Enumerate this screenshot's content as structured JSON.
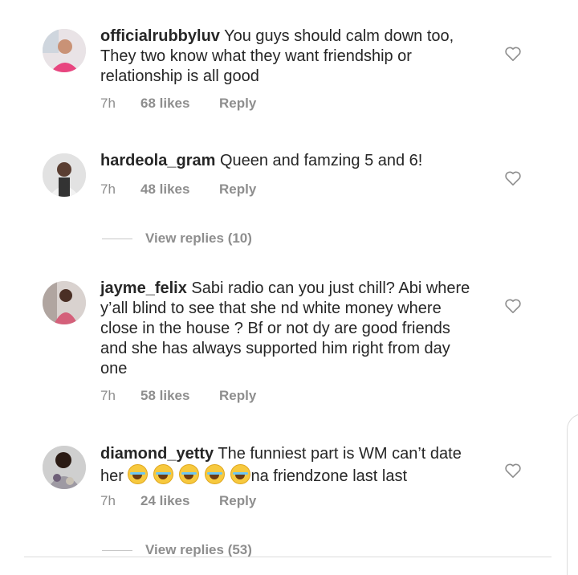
{
  "comments": [
    {
      "username": "officialrubbyluv",
      "text": "You guys should calm down too, They two know what they want friendship or relationship is all good",
      "time": "7h",
      "likes": "68 likes",
      "reply": "Reply",
      "icon": "heart-outline"
    },
    {
      "username": "hardeola_gram",
      "text": "Queen and famzing 5 and 6!",
      "time": "7h",
      "likes": "48 likes",
      "reply": "Reply",
      "view_replies": "View replies (10)",
      "icon": "heart-outline"
    },
    {
      "username": "jayme_felix",
      "text": "Sabi radio can you just chill? Abi where y’all blind to see that she nd white money where close in the house ? Bf or not dy are good friends and she has always supported him right from day one",
      "time": "7h",
      "likes": "58 likes",
      "reply": "Reply",
      "icon": "heart-outline"
    },
    {
      "username": "diamond_yetty",
      "text_before": "The funniest part is WM can’t date her ",
      "emoji": "😂😂😂😂😂",
      "text_after": "na friendzone last last",
      "time": "7h",
      "likes": "24 likes",
      "reply": "Reply",
      "view_replies": "View replies (53)",
      "icon": "heart-outline"
    }
  ],
  "colors": {
    "text": "#262626",
    "secondary": "#8e8e8e",
    "divider": "#dbdbdb"
  }
}
